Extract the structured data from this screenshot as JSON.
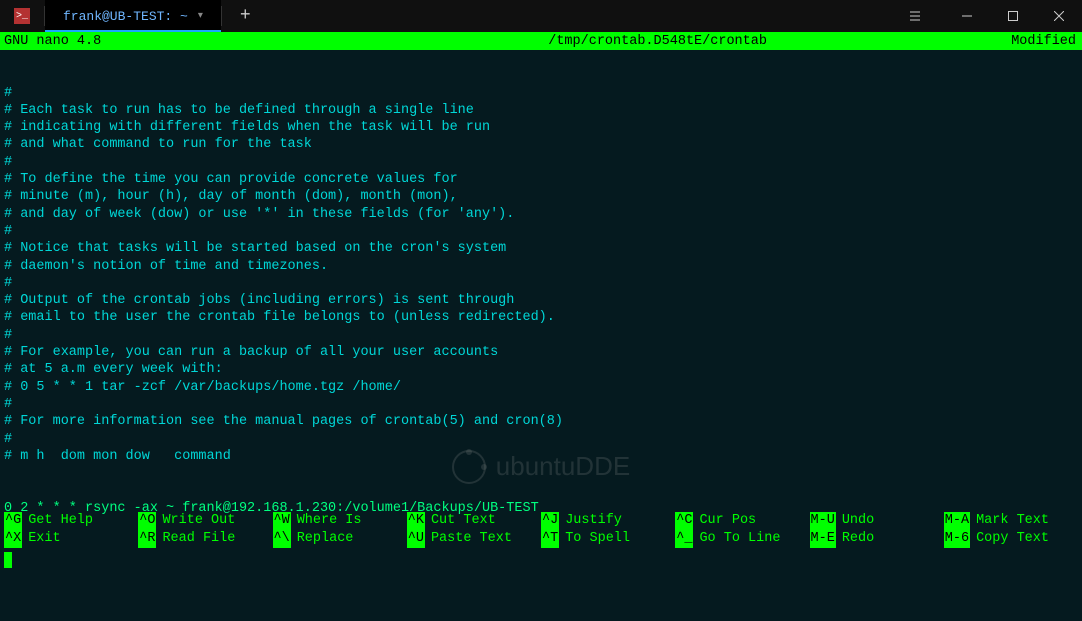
{
  "titlebar": {
    "tab_title": "frank@UB-TEST: ~",
    "icon_glyph": ">_"
  },
  "nano": {
    "app": "GNU nano 4.8",
    "filepath": "/tmp/crontab.D548tE/crontab",
    "status": "Modified"
  },
  "lines": [
    "#",
    "# Each task to run has to be defined through a single line",
    "# indicating with different fields when the task will be run",
    "# and what command to run for the task",
    "#",
    "# To define the time you can provide concrete values for",
    "# minute (m), hour (h), day of month (dom), month (mon),",
    "# and day of week (dow) or use '*' in these fields (for 'any').",
    "#",
    "# Notice that tasks will be started based on the cron's system",
    "# daemon's notion of time and timezones.",
    "#",
    "# Output of the crontab jobs (including errors) is sent through",
    "# email to the user the crontab file belongs to (unless redirected).",
    "#",
    "# For example, you can run a backup of all your user accounts",
    "# at 5 a.m every week with:",
    "# 0 5 * * 1 tar -zcf /var/backups/home.tgz /home/",
    "#",
    "# For more information see the manual pages of crontab(5) and cron(8)",
    "#",
    "# m h  dom mon dow   command"
  ],
  "crontab_line": "0 2 * * * rsync -ax ~ frank@192.168.1.230:/volume1/Backups/UB-TEST",
  "watermark": "ubuntuDDE",
  "shortcuts": {
    "row1": [
      {
        "key": "^G",
        "label": "Get Help"
      },
      {
        "key": "^O",
        "label": "Write Out"
      },
      {
        "key": "^W",
        "label": "Where Is"
      },
      {
        "key": "^K",
        "label": "Cut Text"
      },
      {
        "key": "^J",
        "label": "Justify"
      },
      {
        "key": "^C",
        "label": "Cur Pos"
      },
      {
        "key": "M-U",
        "label": "Undo"
      },
      {
        "key": "M-A",
        "label": "Mark Text"
      }
    ],
    "row2": [
      {
        "key": "^X",
        "label": "Exit"
      },
      {
        "key": "^R",
        "label": "Read File"
      },
      {
        "key": "^\\",
        "label": "Replace"
      },
      {
        "key": "^U",
        "label": "Paste Text"
      },
      {
        "key": "^T",
        "label": "To Spell"
      },
      {
        "key": "^_",
        "label": "Go To Line"
      },
      {
        "key": "M-E",
        "label": "Redo"
      },
      {
        "key": "M-6",
        "label": "Copy Text"
      }
    ]
  }
}
